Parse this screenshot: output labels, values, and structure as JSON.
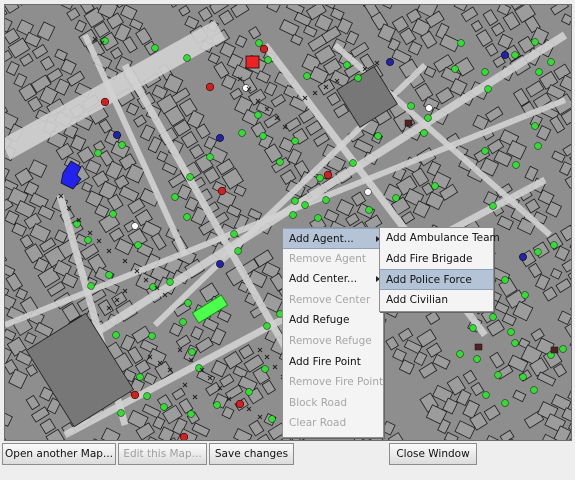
{
  "map": {
    "colors": {
      "background": "#8e8e8e",
      "road": "#d2d2d2",
      "building": "#9c9c9c",
      "building_outline": "#1e1e1e",
      "refuge": "#4cff4c",
      "fire_station": "#2222ee",
      "burning": "#ee2222",
      "civilian": "#33dd33",
      "police": "#2222aa",
      "ambulance": "#ffffff",
      "fire_brigade": "#cc2222",
      "blockade": "#222222"
    }
  },
  "context_menu": {
    "items": [
      {
        "label": "Add Agent...",
        "enabled": true,
        "submenu": true,
        "selected": true
      },
      {
        "label": "Remove Agent",
        "enabled": false
      },
      {
        "label": "Add Center...",
        "enabled": true,
        "submenu": true
      },
      {
        "label": "Remove Center",
        "enabled": false
      },
      {
        "label": "Add Refuge",
        "enabled": true
      },
      {
        "label": "Remove Refuge",
        "enabled": false
      },
      {
        "label": "Add Fire Point",
        "enabled": true
      },
      {
        "label": "Remove Fire Point",
        "enabled": false
      },
      {
        "label": "Block Road",
        "enabled": false
      },
      {
        "label": "Clear Road",
        "enabled": false
      }
    ]
  },
  "submenu": {
    "items": [
      {
        "label": "Add Ambulance Team"
      },
      {
        "label": "Add Fire Brigade"
      },
      {
        "label": "Add Police Force",
        "highlighted": true
      },
      {
        "label": "Add Civilian"
      }
    ]
  },
  "buttons": {
    "open_map": "Open another Map...",
    "edit_map": "Edit this Map...",
    "save_changes": "Save changes",
    "close_window": "Close Window"
  }
}
